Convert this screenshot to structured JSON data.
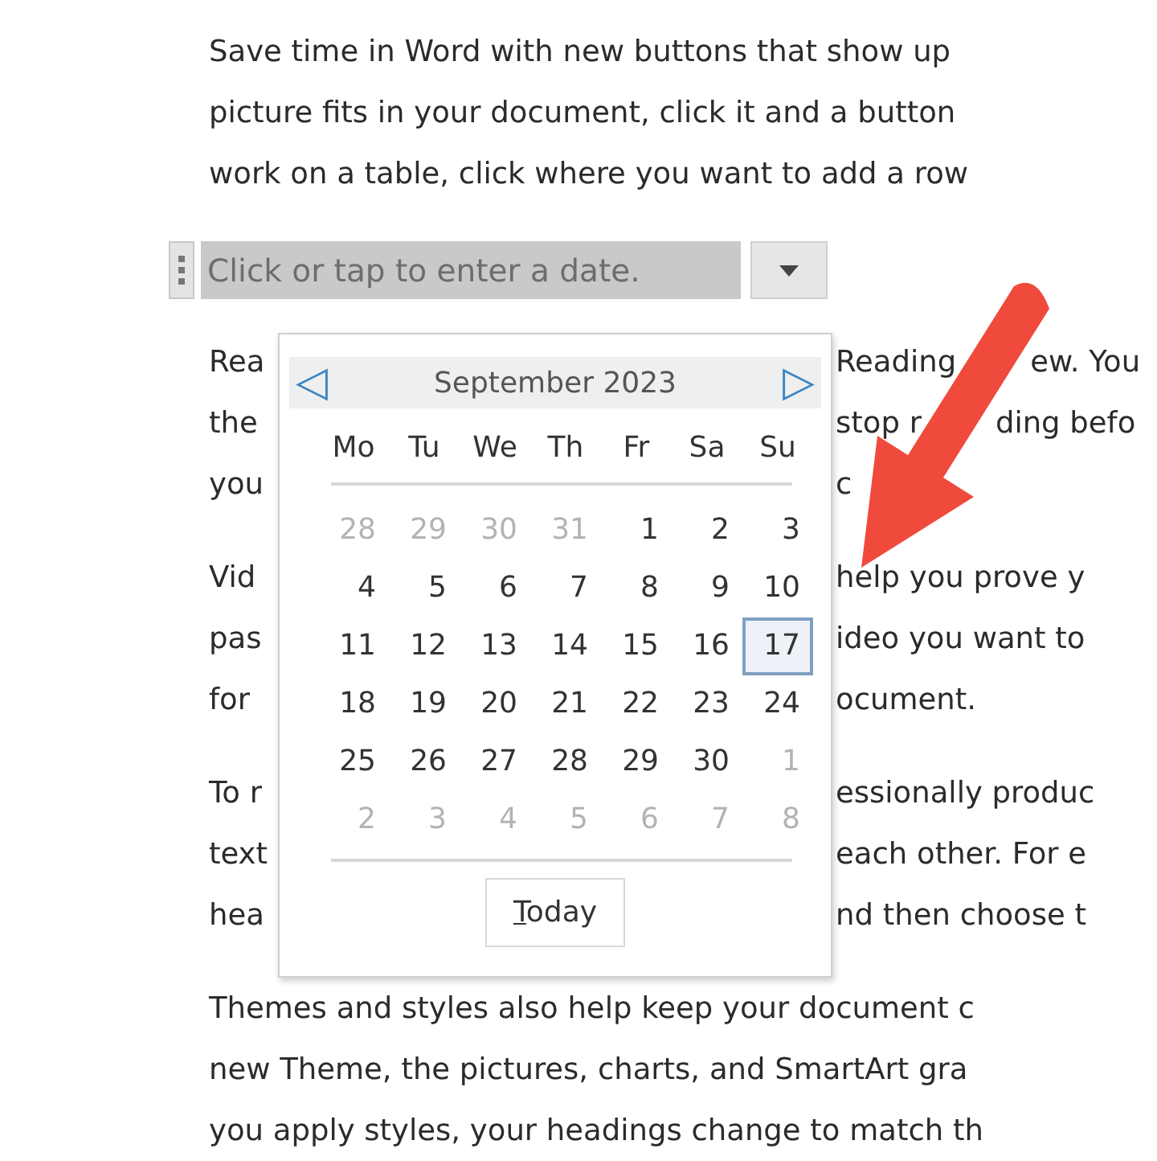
{
  "intro": [
    "Save time in Word with new buttons that show up",
    "picture fits in your document, click it and a button",
    "work on a table, click where you want to add a row"
  ],
  "date_control": {
    "placeholder": "Click or tap to enter a date."
  },
  "paragraphs": [
    [
      {
        "left": "Rea",
        "right": [
          "Reading",
          "ew. You"
        ]
      },
      {
        "left": "the",
        "right": [
          "stop r",
          "ding befo"
        ]
      },
      {
        "left": "you",
        "right": [
          "c"
        ]
      }
    ],
    [
      {
        "left": "Vid",
        "right": [
          "help you prove y"
        ]
      },
      {
        "left": "pas",
        "right": [
          "ideo you want to"
        ]
      },
      {
        "left": "for",
        "right": [
          "ocument."
        ]
      }
    ],
    [
      {
        "left": "To r",
        "right": [
          "essionally produc"
        ]
      },
      {
        "left": "text",
        "right": [
          "each other. For e"
        ]
      },
      {
        "left": "hea",
        "right": [
          "nd then choose t"
        ]
      }
    ],
    [
      {
        "left": "Themes and styles also help keep your document c"
      },
      {
        "left": "new Theme, the pictures, charts, and SmartArt gra"
      },
      {
        "left": "you apply styles, your headings change to match th"
      }
    ]
  ],
  "calendar": {
    "prev": "◁",
    "month": "September 2023",
    "next": "▷",
    "weekdays": [
      "Mo",
      "Tu",
      "We",
      "Th",
      "Fr",
      "Sa",
      "Su"
    ],
    "days": [
      {
        "label": "28",
        "muted": true,
        "selected": false
      },
      {
        "label": "29",
        "muted": true,
        "selected": false
      },
      {
        "label": "30",
        "muted": true,
        "selected": false
      },
      {
        "label": "31",
        "muted": true,
        "selected": false
      },
      {
        "label": "1",
        "muted": false,
        "selected": false
      },
      {
        "label": "2",
        "muted": false,
        "selected": false
      },
      {
        "label": "3",
        "muted": false,
        "selected": false
      },
      {
        "label": "4",
        "muted": false,
        "selected": false
      },
      {
        "label": "5",
        "muted": false,
        "selected": false
      },
      {
        "label": "6",
        "muted": false,
        "selected": false
      },
      {
        "label": "7",
        "muted": false,
        "selected": false
      },
      {
        "label": "8",
        "muted": false,
        "selected": false
      },
      {
        "label": "9",
        "muted": false,
        "selected": false
      },
      {
        "label": "10",
        "muted": false,
        "selected": false
      },
      {
        "label": "11",
        "muted": false,
        "selected": false
      },
      {
        "label": "12",
        "muted": false,
        "selected": false
      },
      {
        "label": "13",
        "muted": false,
        "selected": false
      },
      {
        "label": "14",
        "muted": false,
        "selected": false
      },
      {
        "label": "15",
        "muted": false,
        "selected": false
      },
      {
        "label": "16",
        "muted": false,
        "selected": false
      },
      {
        "label": "17",
        "muted": false,
        "selected": true
      },
      {
        "label": "18",
        "muted": false,
        "selected": false
      },
      {
        "label": "19",
        "muted": false,
        "selected": false
      },
      {
        "label": "20",
        "muted": false,
        "selected": false
      },
      {
        "label": "21",
        "muted": false,
        "selected": false
      },
      {
        "label": "22",
        "muted": false,
        "selected": false
      },
      {
        "label": "23",
        "muted": false,
        "selected": false
      },
      {
        "label": "24",
        "muted": false,
        "selected": false
      },
      {
        "label": "25",
        "muted": false,
        "selected": false
      },
      {
        "label": "26",
        "muted": false,
        "selected": false
      },
      {
        "label": "27",
        "muted": false,
        "selected": false
      },
      {
        "label": "28",
        "muted": false,
        "selected": false
      },
      {
        "label": "29",
        "muted": false,
        "selected": false
      },
      {
        "label": "30",
        "muted": false,
        "selected": false
      },
      {
        "label": "1",
        "muted": true,
        "selected": false
      },
      {
        "label": "2",
        "muted": true,
        "selected": false
      },
      {
        "label": "3",
        "muted": true,
        "selected": false
      },
      {
        "label": "4",
        "muted": true,
        "selected": false
      },
      {
        "label": "5",
        "muted": true,
        "selected": false
      },
      {
        "label": "6",
        "muted": true,
        "selected": false
      },
      {
        "label": "7",
        "muted": true,
        "selected": false
      },
      {
        "label": "8",
        "muted": true,
        "selected": false
      }
    ],
    "today_button": "Today"
  }
}
